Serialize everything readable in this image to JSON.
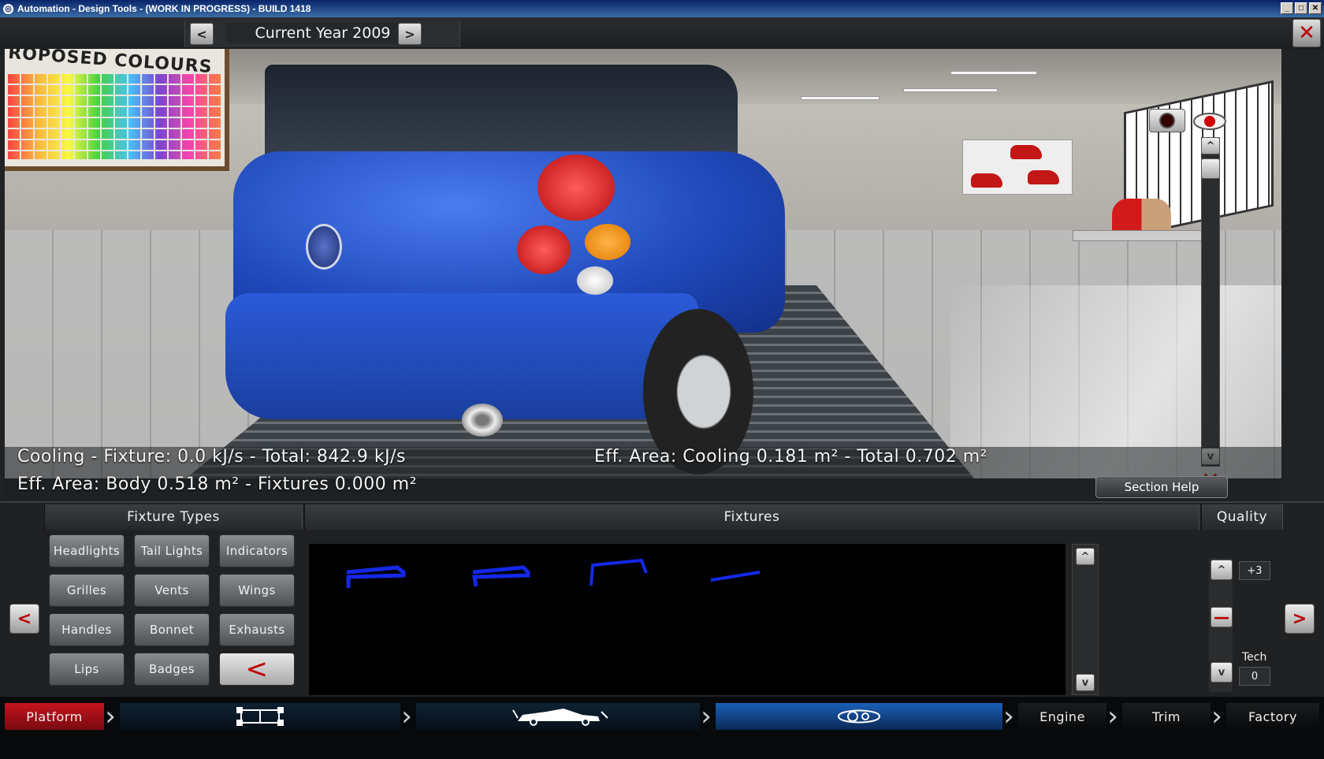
{
  "window": {
    "title": "Automation - Design Tools - (WORK IN PROGRESS) - BUILD 1418",
    "min_label": "_",
    "max_label": "□",
    "close_label": "✕"
  },
  "topbar": {
    "prev_label": "<",
    "next_label": ">",
    "year_label": "Current Year 2009",
    "close_label": "✕"
  },
  "scene": {
    "board_text": "ROPOSED COLOURS"
  },
  "info": {
    "cooling": "Cooling - Fixture: 0.0 kJ/s - Total: 842.9 kJ/s",
    "eff_area_cooling": "Eff. Area: Cooling 0.181 m² - Total 0.702 m²",
    "eff_area_body": "Eff. Area: Body 0.518 m² - Fixtures 0.000 m²",
    "section_help": "Section Help"
  },
  "view_controls": {
    "up_label": "^",
    "down_label": "v",
    "hide_label": "✕"
  },
  "panel": {
    "fixture_types_header": "Fixture Types",
    "fixtures_header": "Fixtures",
    "quality_header": "Quality",
    "fixture_types": [
      "Headlights",
      "Tail Lights",
      "Indicators",
      "Grilles",
      "Vents",
      "Wings",
      "Handles",
      "Bonnet",
      "Exhausts",
      "Lips",
      "Badges"
    ],
    "back_label": "<",
    "left_arrow": "<",
    "right_arrow": ">",
    "scroll_up": "^",
    "scroll_down": "v",
    "quality_up": "^",
    "quality_down": "v",
    "quality_value": "+3",
    "tech_label": "Tech",
    "tech_value": "0"
  },
  "nav": {
    "platform": "Platform",
    "engine": "Engine",
    "trim": "Trim",
    "factory": "Factory",
    "active_color": "#1a5fb8",
    "platform_color": "#b0101a"
  }
}
